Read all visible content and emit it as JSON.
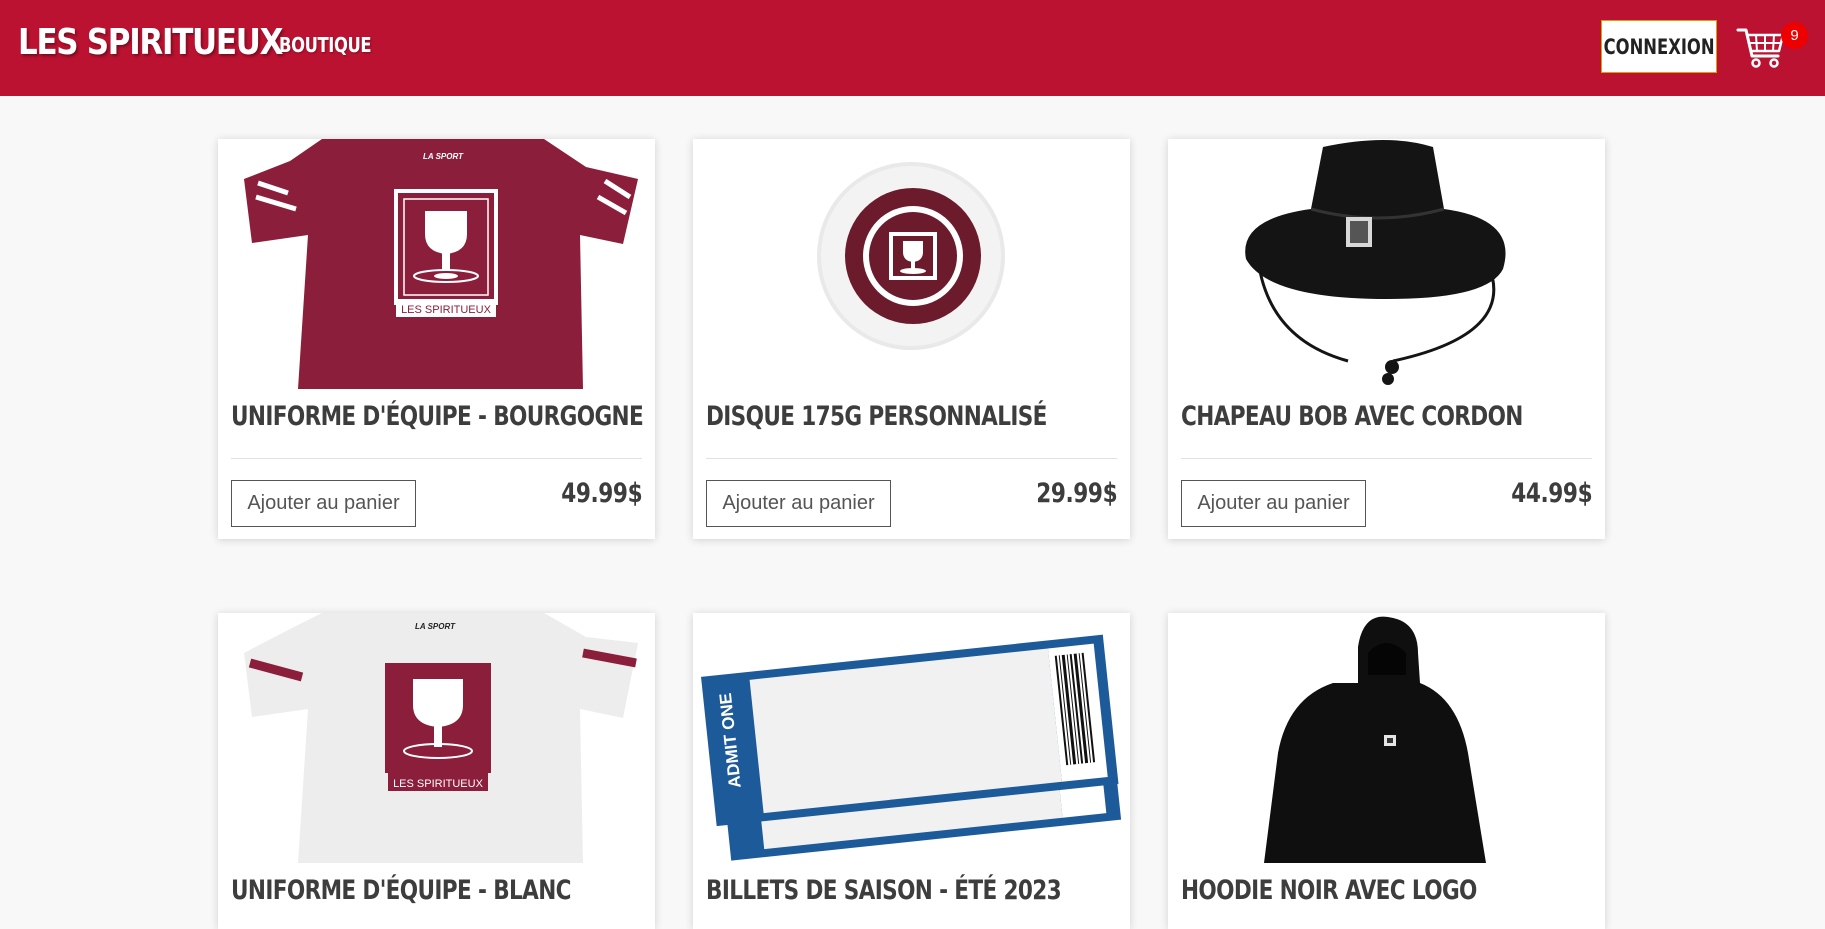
{
  "header": {
    "brand": "LES SPIRITUEUX",
    "nav": [
      "BOUTIQUE"
    ],
    "login_label": "CONNEXION",
    "cart_icon": "shopping-cart-icon",
    "cart_count": "9"
  },
  "colors": {
    "header_bg": "#ba1230",
    "burgundy": "#8b1e3a",
    "title_text": "#3d3d3d",
    "cart_badge": "#ee0000",
    "ticket_blue": "#1d5a99"
  },
  "products": [
    {
      "title": "UNIFORME D'ÉQUIPE - BOURGOGNE",
      "price": "49.99$",
      "button": "Ajouter au panier",
      "image": "burgundy-jersey-image",
      "jersey_text": "LA SPORT",
      "logo_text": "LES SPIRITUEUX"
    },
    {
      "title": "DISQUE 175G PERSONNALISÉ",
      "price": "29.99$",
      "button": "Ajouter au panier",
      "image": "disc-image"
    },
    {
      "title": "CHAPEAU BOB AVEC CORDON",
      "price": "44.99$",
      "button": "Ajouter au panier",
      "image": "bucket-hat-image"
    },
    {
      "title": "UNIFORME D'ÉQUIPE - BLANC",
      "image": "white-jersey-image",
      "jersey_text": "LA SPORT",
      "logo_text": "LES SPIRITUEUX"
    },
    {
      "title": "BILLETS DE SAISON - ÉTÉ 2023",
      "image": "tickets-image",
      "ticket_text": "ADMIT ONE"
    },
    {
      "title": "HOODIE NOIR AVEC LOGO",
      "image": "black-hoodie-image"
    }
  ]
}
